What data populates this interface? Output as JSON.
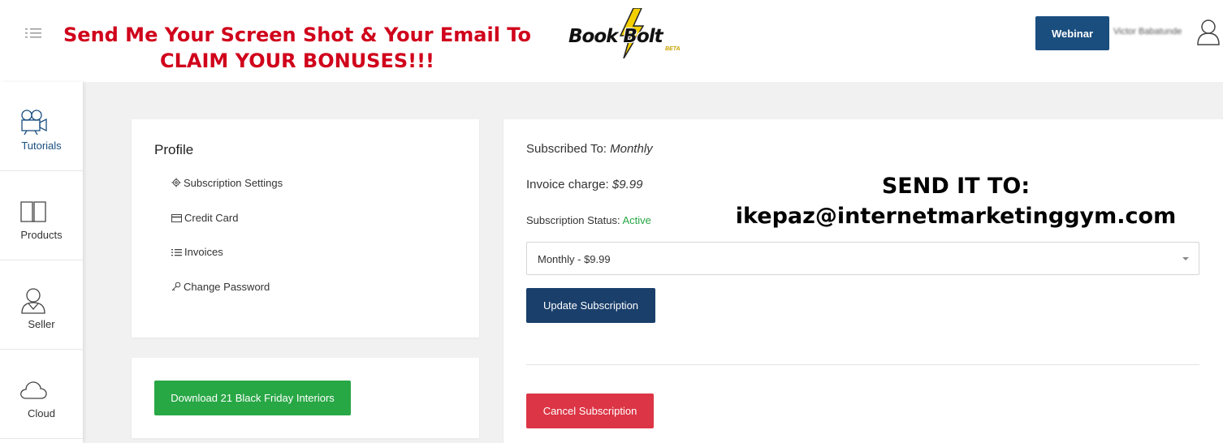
{
  "header": {
    "promo_line1": "Send Me Your Screen Shot & Your Email To",
    "promo_line2": "CLAIM YOUR BONUSES!!!",
    "logo_text": "Book Bolt",
    "logo_badge": "BETA",
    "webinar_label": "Webinar",
    "username": "Victor Babatunde"
  },
  "sidebar": {
    "items": [
      {
        "label": "Tutorials",
        "icon": "video-camera-icon",
        "active": true
      },
      {
        "label": "Products",
        "icon": "book-icon",
        "active": false
      },
      {
        "label": "Seller",
        "icon": "seller-user-icon",
        "active": false
      },
      {
        "label": "Cloud",
        "icon": "cloud-icon",
        "active": false
      }
    ]
  },
  "profile": {
    "title": "Profile",
    "links": [
      {
        "label": "Subscription Settings",
        "icon": "gear-icon"
      },
      {
        "label": "Credit Card",
        "icon": "credit-card-icon"
      },
      {
        "label": "Invoices",
        "icon": "list-icon"
      },
      {
        "label": "Change Password",
        "icon": "key-icon"
      }
    ]
  },
  "download": {
    "label": "Download 21 Black Friday Interiors"
  },
  "subscription": {
    "subscribed_label": "Subscribed To: ",
    "subscribed_value": "Monthly",
    "invoice_label": "Invoice charge: ",
    "invoice_value": "$9.99",
    "status_label": "Subscription Status: ",
    "status_value": "Active",
    "plan_selected": "Monthly - $9.99",
    "update_label": "Update Subscription",
    "cancel_label": "Cancel Subscription"
  },
  "overlay": {
    "title": "SEND IT TO:",
    "email": "ikepaz@internetmarketinggym.com"
  },
  "colors": {
    "primary": "#1a4e7f",
    "promo_red": "#d0021b",
    "success": "#28a745",
    "danger": "#dc3545"
  }
}
